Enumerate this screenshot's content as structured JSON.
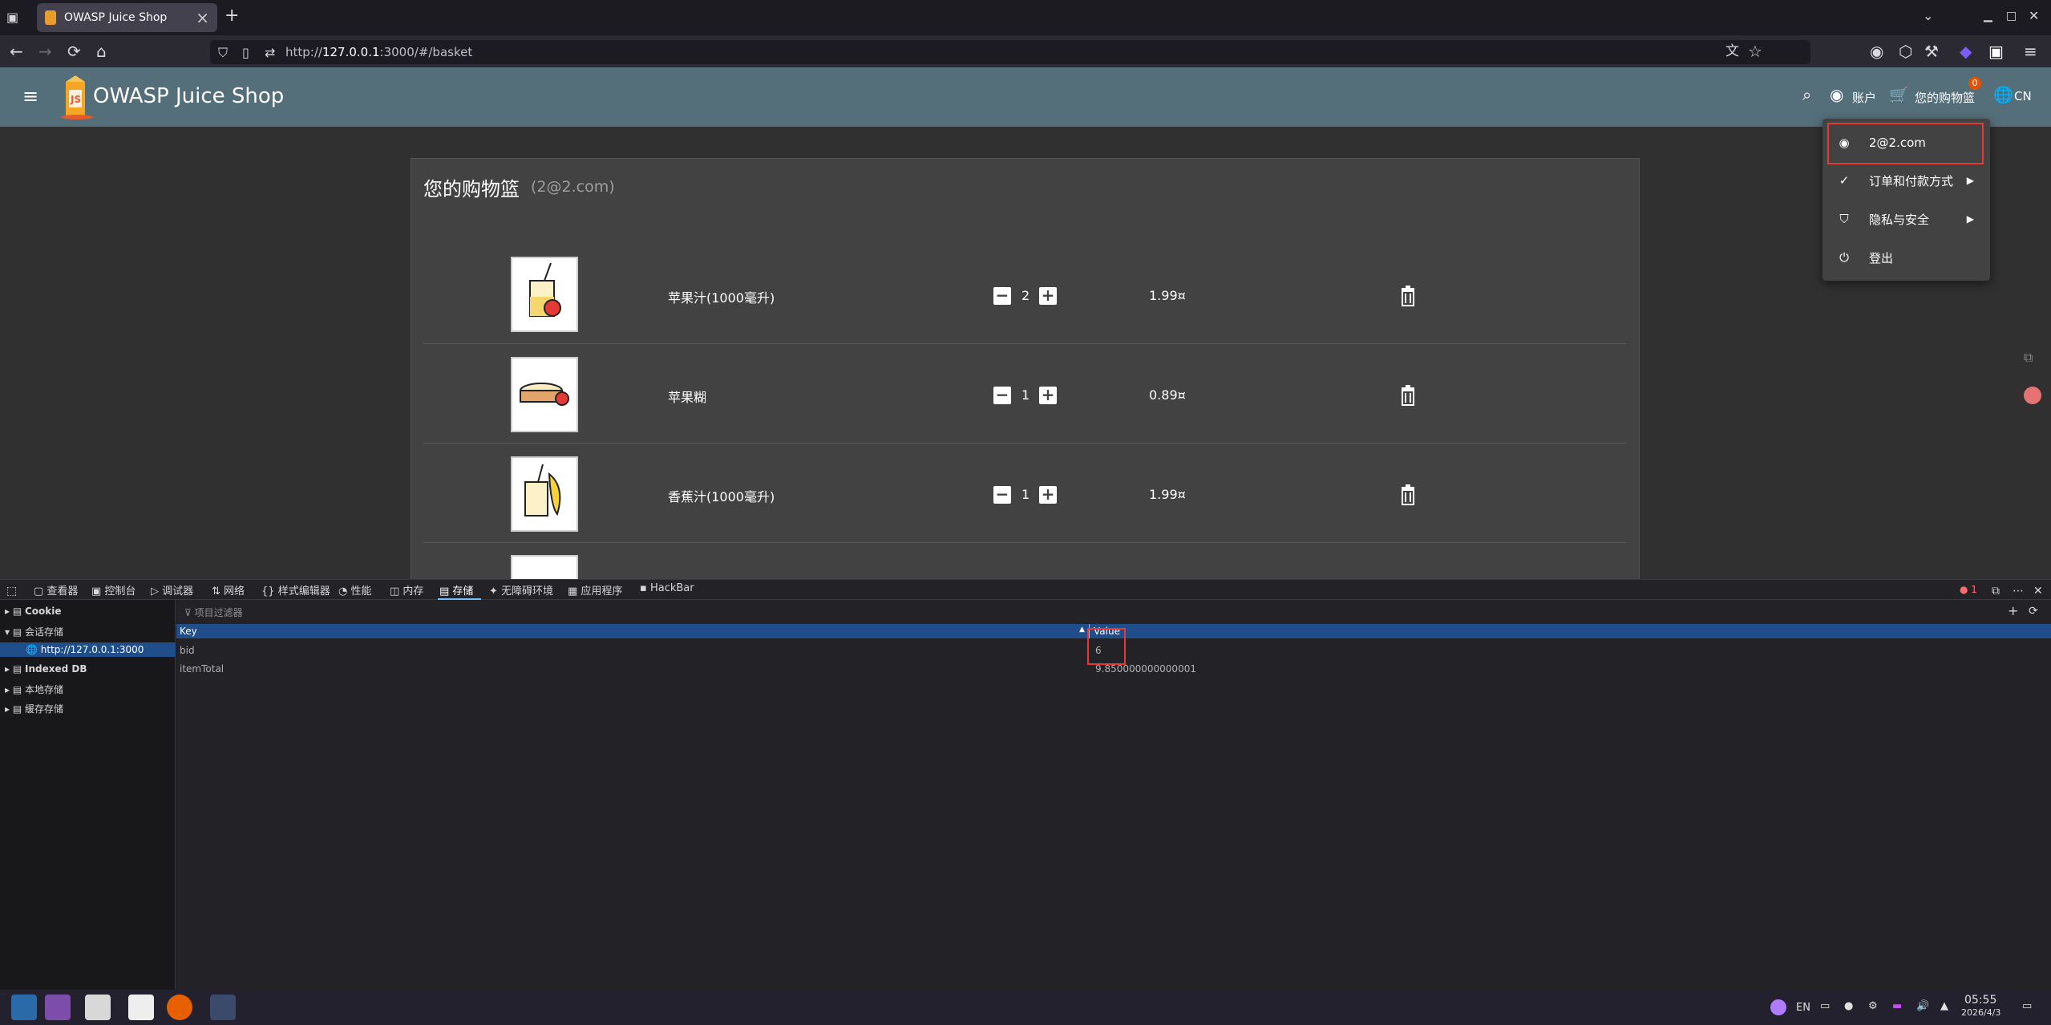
{
  "browser": {
    "tab_title": "OWASP Juice Shop",
    "url_prefix": "http://",
    "url_host": "127.0.0.1",
    "url_rest": ":3000/#/basket"
  },
  "app": {
    "name": "OWASP Juice Shop",
    "account_label": "账户",
    "basket_label": "您的购物篮",
    "basket_count": "0",
    "language": "CN"
  },
  "basket": {
    "title": "您的购物篮",
    "user": "(2@2.com)",
    "items": [
      {
        "name": "苹果汁(1000毫升)",
        "quantity": "2",
        "price": "1.99¤"
      },
      {
        "name": "苹果糊",
        "quantity": "1",
        "price": "0.89¤"
      },
      {
        "name": "香蕉汁(1000毫升)",
        "quantity": "1",
        "price": "1.99¤"
      }
    ]
  },
  "account_menu": {
    "email": "2@2.com",
    "orders": "订单和付款方式",
    "privacy": "隐私与安全",
    "logout": "登出"
  },
  "devtools": {
    "tabs": [
      "查看器",
      "控制台",
      "调试器",
      "网络",
      "样式编辑器",
      "性能",
      "内存",
      "存储",
      "无障碍环境",
      "应用程序",
      "HackBar"
    ],
    "error_count": "1",
    "sidebar": {
      "cookie": "Cookie",
      "session": "会话存储",
      "session_origin": "http://127.0.0.1:3000",
      "indexed": "Indexed DB",
      "local": "本地存储",
      "cache": "缓存存储"
    },
    "filter_placeholder": "项目过滤器",
    "columns": {
      "key": "Key",
      "value": "Value"
    },
    "rows": [
      {
        "key": "bid",
        "value": "6"
      },
      {
        "key": "itemTotal",
        "value": "9.850000000000001"
      }
    ]
  },
  "taskbar": {
    "lang": "EN",
    "time": "05:55",
    "date": "2026/4/3"
  },
  "colors": {
    "header": "#546e7a",
    "card": "#424242",
    "highlight": "#e53935",
    "devtools_selection": "#204e8a"
  }
}
